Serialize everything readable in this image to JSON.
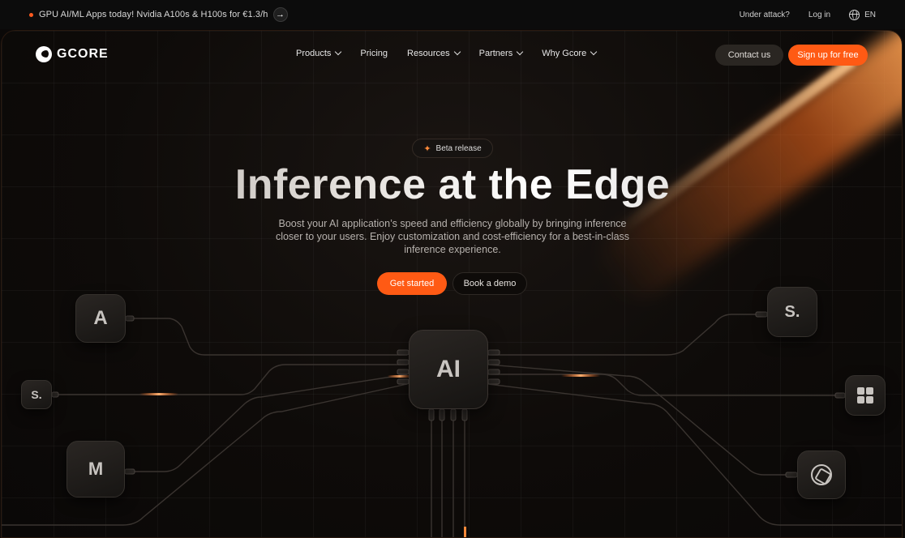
{
  "topbar": {
    "promo": "GPU AI/ML Apps today! Nvidia A100s & H100s for €1.3/h",
    "under_attack": "Under attack?",
    "login": "Log in",
    "language": "EN"
  },
  "brand": {
    "name": "GCORE",
    "accent": "#ff5a14"
  },
  "nav": {
    "items": [
      {
        "label": "Products",
        "has_dropdown": true
      },
      {
        "label": "Pricing",
        "has_dropdown": false
      },
      {
        "label": "Resources",
        "has_dropdown": true
      },
      {
        "label": "Partners",
        "has_dropdown": true
      },
      {
        "label": "Why Gcore",
        "has_dropdown": true
      }
    ],
    "contact": "Contact us",
    "signup": "Sign up for free"
  },
  "hero": {
    "badge": "Beta release",
    "title": "Inference at the Edge",
    "subtitle": "Boost your AI application’s speed and efficiency globally by bringing inference closer to your users. Enjoy customization and cost-efficiency for a best-in-class inference experience.",
    "primary_cta": "Get started",
    "secondary_cta": "Book a demo"
  },
  "diagram": {
    "chip_label": "AI",
    "nodes": {
      "left_1": "A",
      "left_2": "S.",
      "left_3": "M",
      "right_1": "S."
    }
  }
}
